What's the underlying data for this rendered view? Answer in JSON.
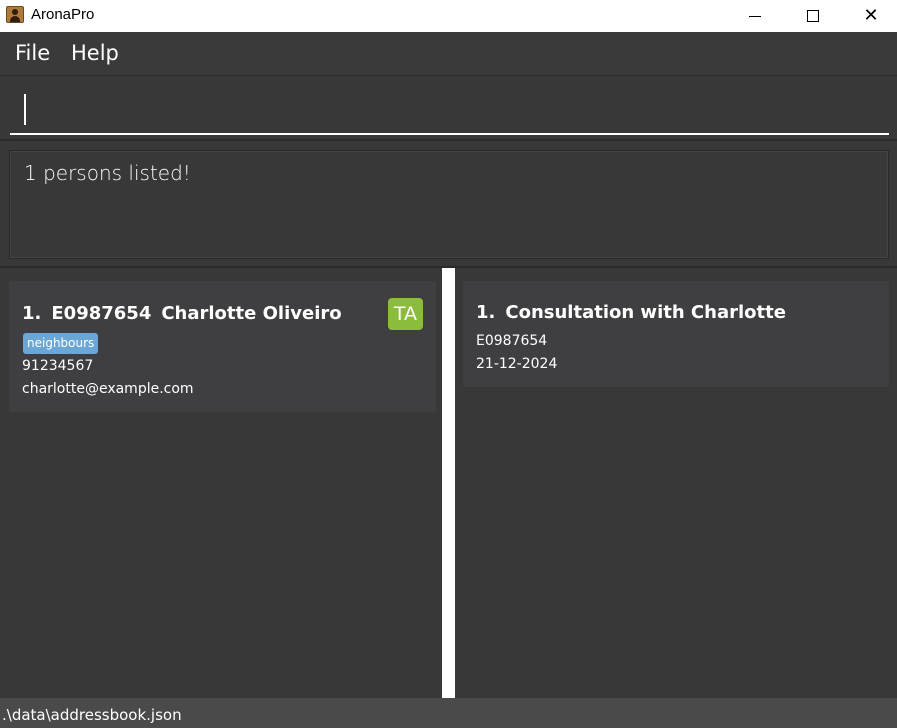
{
  "window": {
    "title": "AronaPro",
    "app_icon": "address-book-icon",
    "controls": {
      "minimize_icon": "minimize-icon",
      "maximize_icon": "maximize-icon",
      "close_icon": "close-icon",
      "close_glyph": "✕"
    }
  },
  "menu": {
    "file_label": "File",
    "help_label": "Help"
  },
  "command": {
    "value": "",
    "placeholder": ""
  },
  "result": {
    "message": "1 persons listed!"
  },
  "persons": [
    {
      "index": "1.",
      "student_id": "E0987654",
      "name": "Charlotte Oliveiro",
      "role": "TA",
      "tags": [
        "neighbours"
      ],
      "phone": "91234567",
      "email": "charlotte@example.com"
    }
  ],
  "appointments": [
    {
      "index": "1.",
      "title": "Consultation with Charlotte",
      "student_id": "E0987654",
      "date": "21-12-2024"
    }
  ],
  "status": {
    "file_path": ".\\data\\addressbook.json"
  },
  "colors": {
    "background": "#383838",
    "card": "#3f3f42",
    "role_badge": "#8bbd3a",
    "tag": "#6aa6d6",
    "statusbar": "#4a4a4a"
  }
}
